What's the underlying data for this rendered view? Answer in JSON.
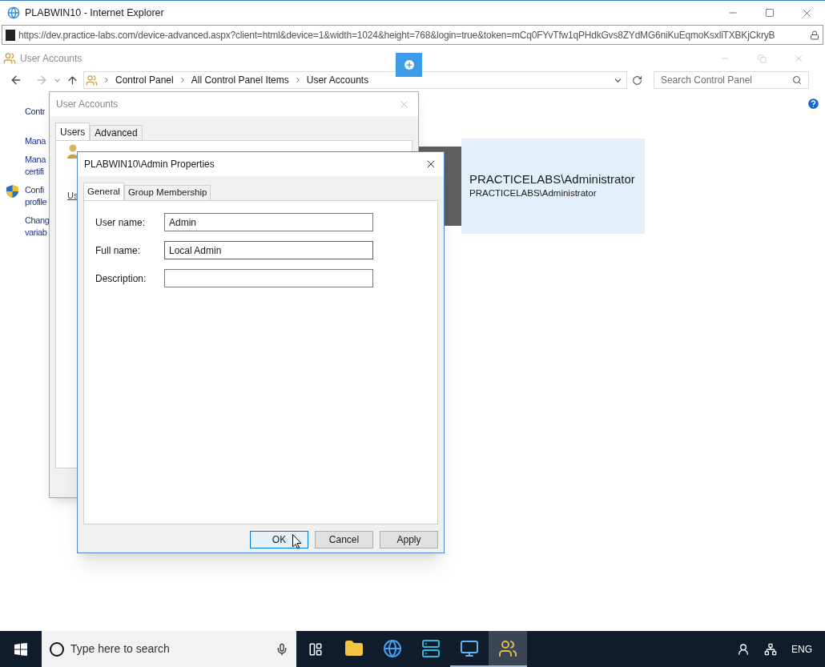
{
  "browser": {
    "title": "PLABWIN10 - Internet Explorer",
    "url": "https://dev.practice-labs.com/device-advanced.aspx?client=html&device=1&width=1024&height=768&login=true&token=mCq0FYvTfw1qPHdkGvs8ZYdMG6niKuEqmoKsxliTXBKjCkryB"
  },
  "control_panel": {
    "title": "User Accounts",
    "breadcrumb": [
      "Control Panel",
      "All Control Panel Items",
      "User Accounts"
    ],
    "search": {
      "placeholder": "Search Control Panel"
    },
    "sidebar": [
      {
        "lines": [
          "Contr"
        ],
        "shield": false
      },
      {
        "lines": [
          "Mana"
        ],
        "shield": false
      },
      {
        "lines": [
          "Mana",
          "certifi"
        ],
        "shield": false
      },
      {
        "lines": [
          "Confi",
          "profile"
        ],
        "shield": true
      },
      {
        "lines": [
          "Chang",
          "variab"
        ],
        "shield": false
      }
    ],
    "account": {
      "name": "PRACTICELABS\\Administrator",
      "subtitle": "PRACTICELABS\\Administrator"
    }
  },
  "user_accounts_dialog": {
    "title": "User Accounts",
    "tabs": [
      {
        "label": "Users",
        "selected": true
      },
      {
        "label": "Advanced",
        "selected": false
      }
    ],
    "partial_label": "Us"
  },
  "properties_dialog": {
    "title": "PLABWIN10\\Admin Properties",
    "tabs": [
      {
        "label": "General",
        "selected": true
      },
      {
        "label": "Group Membership",
        "selected": false
      }
    ],
    "fields": [
      {
        "label": "User name:",
        "value": "Admin",
        "focused": false
      },
      {
        "label": "Full name:",
        "value": "Local Admin",
        "focused": true
      },
      {
        "label": "Description:",
        "focused": false
      }
    ],
    "buttons": [
      {
        "label": "OK",
        "default": true
      },
      {
        "label": "Cancel",
        "default": false
      },
      {
        "label": "Apply",
        "default": false
      }
    ]
  },
  "taskbar": {
    "search": {
      "placeholder": "Type here to search"
    },
    "apps": [
      {
        "kind": "folder",
        "running": false,
        "selected": false
      },
      {
        "kind": "browser",
        "running": false,
        "selected": false
      },
      {
        "kind": "server",
        "running": false,
        "selected": false
      },
      {
        "kind": "monitor",
        "running": true,
        "selected": false
      },
      {
        "kind": "users",
        "running": true,
        "selected": true
      }
    ],
    "language": "ENG"
  }
}
